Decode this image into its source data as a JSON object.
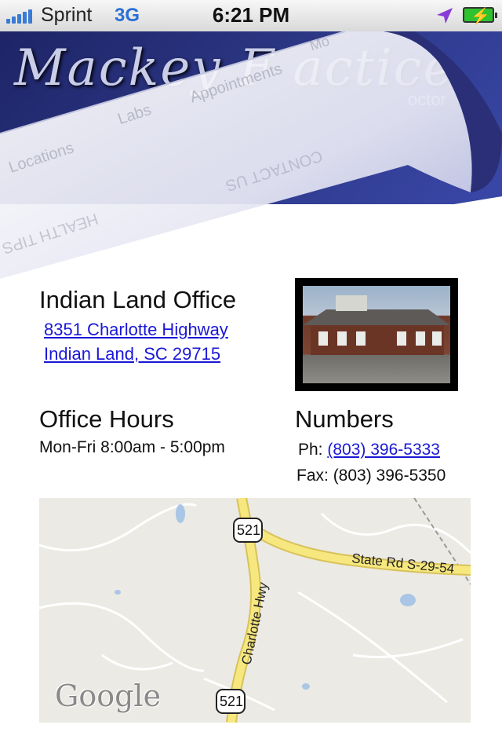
{
  "status_bar": {
    "carrier": "Sprint",
    "network": "3G",
    "time": "6:21 PM",
    "icons": [
      "signal-icon",
      "location-arrow-icon",
      "battery-charging-icon"
    ]
  },
  "banner": {
    "title": "Mackey F          actice",
    "subtitle": "octor",
    "curl_menu": [
      "Locations",
      "Labs",
      "Appointments",
      "Mo",
      "CONTACT US",
      "HEALTH TIPS"
    ]
  },
  "office": {
    "title": "Indian Land Office",
    "address_line1": "8351 Charlotte Highway",
    "address_line2": "Indian Land, SC 29715"
  },
  "hours": {
    "title": "Office Hours",
    "line": "Mon-Fri 8:00am - 5:00pm"
  },
  "numbers": {
    "title": "Numbers",
    "phone_label": "Ph:",
    "phone": "(803) 396-5333",
    "fax_label": "Fax:",
    "fax": "(803) 396-5350"
  },
  "map": {
    "labels": [
      "521",
      "521",
      "State Rd S-29-54",
      "Charlotte Hwy"
    ],
    "attribution": "Google"
  },
  "colors": {
    "banner": "#2e3a8a",
    "link": "#1a17d6",
    "signal": "#3a7bd5",
    "battery": "#2fc22f"
  }
}
